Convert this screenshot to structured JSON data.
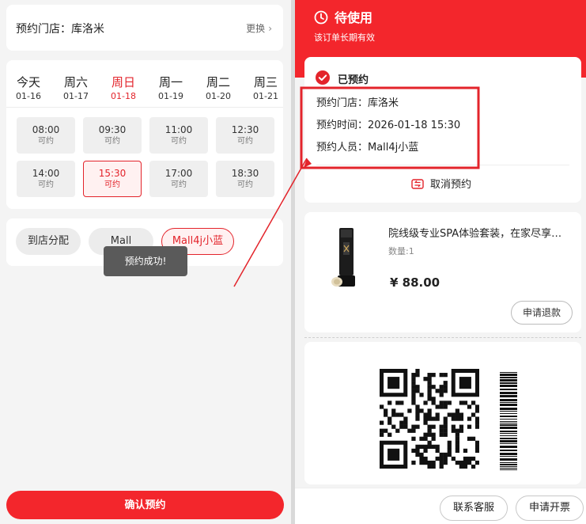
{
  "left": {
    "store": {
      "label": "预约门店：库洛米",
      "change": "更换"
    },
    "days": [
      {
        "name": "今天",
        "date": "01-16"
      },
      {
        "name": "周六",
        "date": "01-17"
      },
      {
        "name": "周日",
        "date": "01-18"
      },
      {
        "name": "周一",
        "date": "01-19"
      },
      {
        "name": "周二",
        "date": "01-20"
      },
      {
        "name": "周三",
        "date": "01-21"
      }
    ],
    "active_day_index": 2,
    "slots": [
      {
        "time": "08:00",
        "state": "可约"
      },
      {
        "time": "09:30",
        "state": "可约"
      },
      {
        "time": "11:00",
        "state": "可约"
      },
      {
        "time": "12:30",
        "state": "可约"
      },
      {
        "time": "14:00",
        "state": "可约"
      },
      {
        "time": "15:30",
        "state": "可约"
      },
      {
        "time": "17:00",
        "state": "可约"
      },
      {
        "time": "18:30",
        "state": "可约"
      }
    ],
    "selected_slot_index": 5,
    "staff": [
      "到店分配",
      "Mall",
      "Mall4j小蓝"
    ],
    "toast": "预约成功!",
    "confirm_label": "确认预约"
  },
  "right": {
    "status_title": "待使用",
    "status_sub": "该订单长期有效",
    "appointment": {
      "status": "已预约",
      "store": "预约门店：库洛米",
      "time": "预约时间：2026-01-18 15:30",
      "person": "预约人员：Mall4j小蓝",
      "cancel": "取消预约"
    },
    "product": {
      "name": "院线级专业SPA体验套装，在家尽享五星级呵护",
      "qty": "数量:1",
      "price": "¥ 88.00",
      "refund": "申请退款"
    },
    "bottom": {
      "service": "联系客服",
      "invoice": "申请开票"
    }
  },
  "colors": {
    "accent": "#f3262c",
    "annotation": "#e3242b"
  },
  "icons": [
    "clock-icon",
    "check-circle-icon",
    "cancel-icon",
    "chevron-right-icon",
    "qr-code-icon",
    "barcode-icon"
  ]
}
